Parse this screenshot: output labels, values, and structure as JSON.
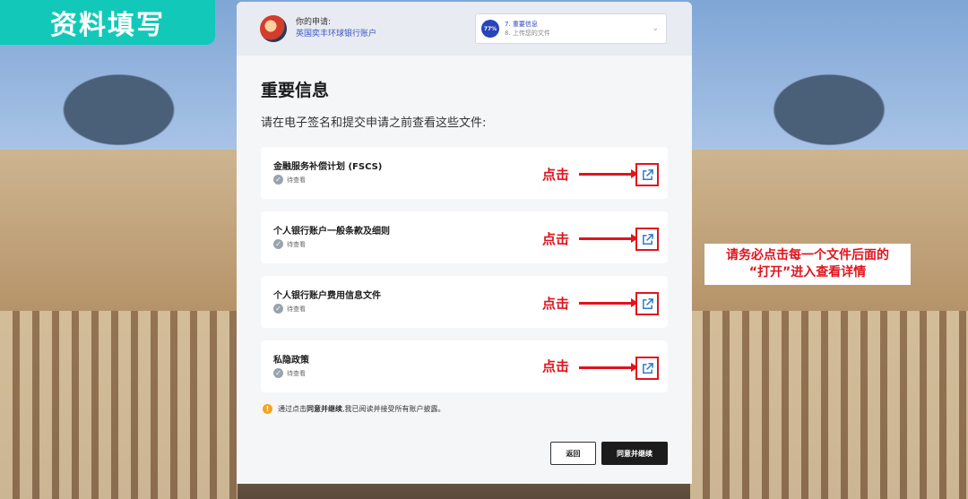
{
  "banner": {
    "title": "资料填写"
  },
  "header": {
    "application_label": "你的申请:",
    "application_value": "英国奕丰环球银行账户",
    "progress": "77%",
    "current_step": "7. 重要信息",
    "next_step": "8. 上传您的文件"
  },
  "main": {
    "heading": "重要信息",
    "subheading": "请在电子签名和提交申请之前查看这些文件:",
    "documents": [
      {
        "title": "金融服务补偿计划 (FSCS)",
        "status": "待查看"
      },
      {
        "title": "个人银行账户一般条款及细则",
        "status": "待查看"
      },
      {
        "title": "个人银行账户费用信息文件",
        "status": "待查看"
      },
      {
        "title": "私隐政策",
        "status": "待查看"
      }
    ],
    "annotation_click": "点击",
    "notice_prefix": "通过点击",
    "notice_bold": "同意并继续",
    "notice_suffix": ",我已阅读并接受所有账户披露。",
    "back_label": "返回",
    "agree_label": "同意并继续"
  },
  "callout": {
    "line1": "请务必点击每一个文件后面的",
    "line2": "“打开”进入查看详情"
  },
  "colors": {
    "accent": "#12c9b9",
    "primary": "#2744b8",
    "annotation": "#e0141e"
  }
}
